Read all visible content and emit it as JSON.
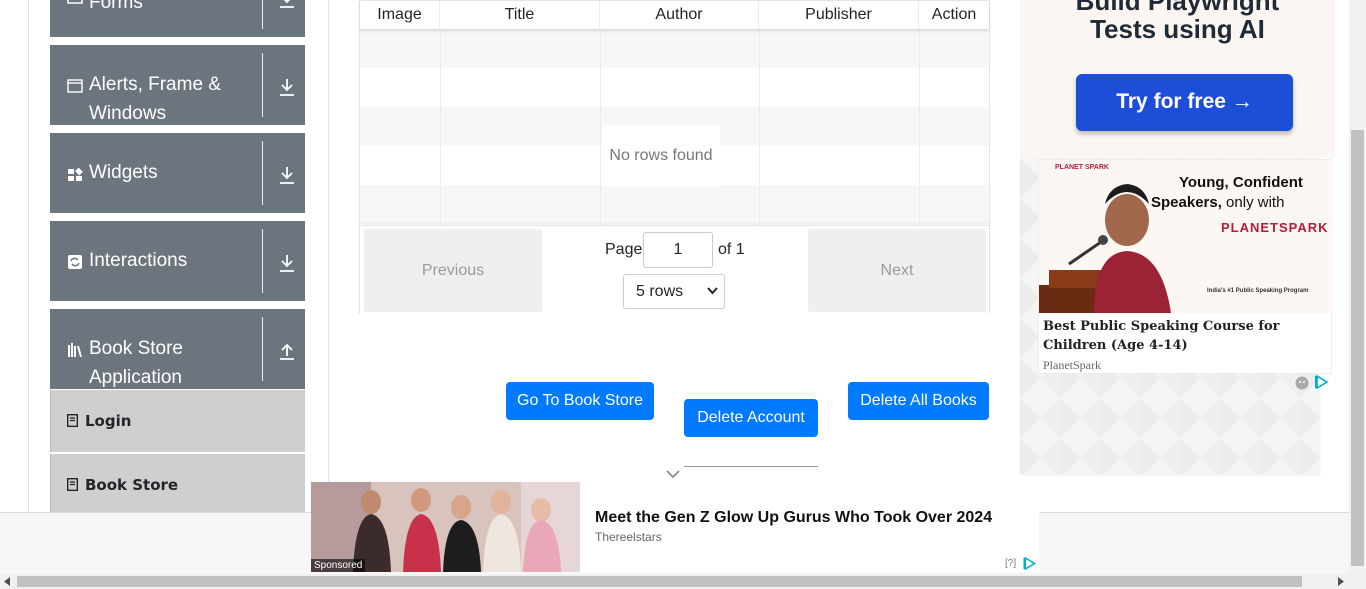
{
  "sidebar": {
    "groups": [
      {
        "label": "Forms"
      },
      {
        "label": "Alerts, Frame &",
        "label2": "Windows"
      },
      {
        "label": "Widgets"
      },
      {
        "label": "Interactions"
      },
      {
        "label": "Book Store",
        "label2": "Application"
      }
    ],
    "items": [
      {
        "label": "Login"
      },
      {
        "label": "Book Store"
      }
    ]
  },
  "table": {
    "columns": [
      "Image",
      "Title",
      "Author",
      "Publisher",
      "Action"
    ],
    "empty_text": "No rows found"
  },
  "pagination": {
    "previous_label": "Previous",
    "next_label": "Next",
    "page_label": "Page",
    "page_value": "1",
    "of_label": "of 1",
    "rows_selected": "5 rows"
  },
  "actions": {
    "go_to_store": "Go To Book Store",
    "delete_account": "Delete Account",
    "delete_all_books": "Delete All Books"
  },
  "ads": {
    "top": {
      "headline_line1": "Build Playwright",
      "headline_line2": "Tests using AI",
      "cta": "Try for free →"
    },
    "planetspark": {
      "brand_small": "PLANET SPARK",
      "tagline_line1": "Young, Confident",
      "tagline_line2_bold": "Speakers,",
      "tagline_line2_rest": " only with",
      "brand": "PLANETSPARK",
      "program": "India's #1 Public Speaking Program",
      "title": "Best Public Speaking Course for Children (Age 4-14)",
      "advertiser": "PlanetSpark"
    },
    "bottom": {
      "sponsored": "Sponsored",
      "headline": "Meet the Gen Z Glow Up Gurus Who Took Over 2024",
      "source": "Thereelstars",
      "help": "[?]"
    }
  },
  "colors": {
    "sidebar_group_bg": "#6c757d",
    "menu_item_bg": "#cfcfcf",
    "primary_button": "#007bff",
    "ad_cta": "#1d4ed8"
  }
}
